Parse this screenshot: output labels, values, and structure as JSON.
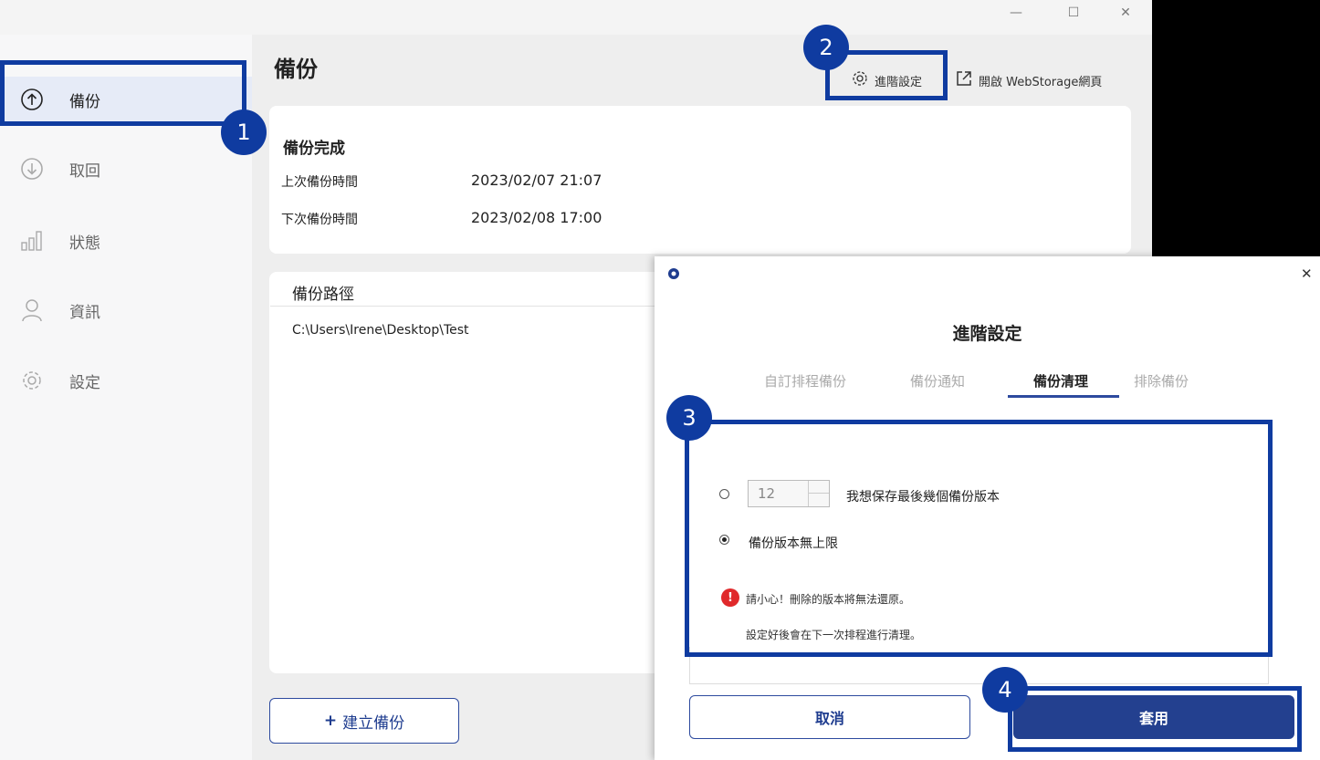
{
  "window": {
    "minimize": "—",
    "maximize": "☐",
    "close": "✕"
  },
  "sidebar": {
    "items": [
      {
        "label": "備份",
        "icon": "cloud-upload-icon"
      },
      {
        "label": "取回",
        "icon": "cloud-download-icon"
      },
      {
        "label": "狀態",
        "icon": "bar-chart-icon"
      },
      {
        "label": "資訊",
        "icon": "user-icon"
      },
      {
        "label": "設定",
        "icon": "gear-icon"
      }
    ]
  },
  "main": {
    "title": "備份",
    "advanced_link": "進階設定",
    "webstorage_link": "開啟 WebStorage網頁",
    "status": {
      "title": "備份完成",
      "last_label": "上次備份時間",
      "last_value": "2023/02/07 21:07",
      "next_label": "下次備份時間",
      "next_value": "2023/02/08 17:00"
    },
    "path": {
      "header": "備份路徑",
      "value": "C:\\Users\\Irene\\Desktop\\Test"
    },
    "create_button": "建立備份",
    "create_plus": "+"
  },
  "dialog": {
    "title": "進階設定",
    "close": "✕",
    "tabs": [
      "自訂排程備份",
      "備份通知",
      "備份清理",
      "排除備份"
    ],
    "active_tab": 2,
    "keep_count": "12",
    "option_keep": "我想保存最後幾個備份版本",
    "option_unlimited": "備份版本無上限",
    "warning": "請小心！刪除的版本將無法還原。",
    "note": "設定好後會在下一次排程進行清理。",
    "cancel": "取消",
    "apply": "套用"
  },
  "annotations": [
    "1",
    "2",
    "3",
    "4"
  ],
  "colors": {
    "accent": "#23408f",
    "annotation": "#0f3ba0",
    "warning": "#e0292b"
  }
}
